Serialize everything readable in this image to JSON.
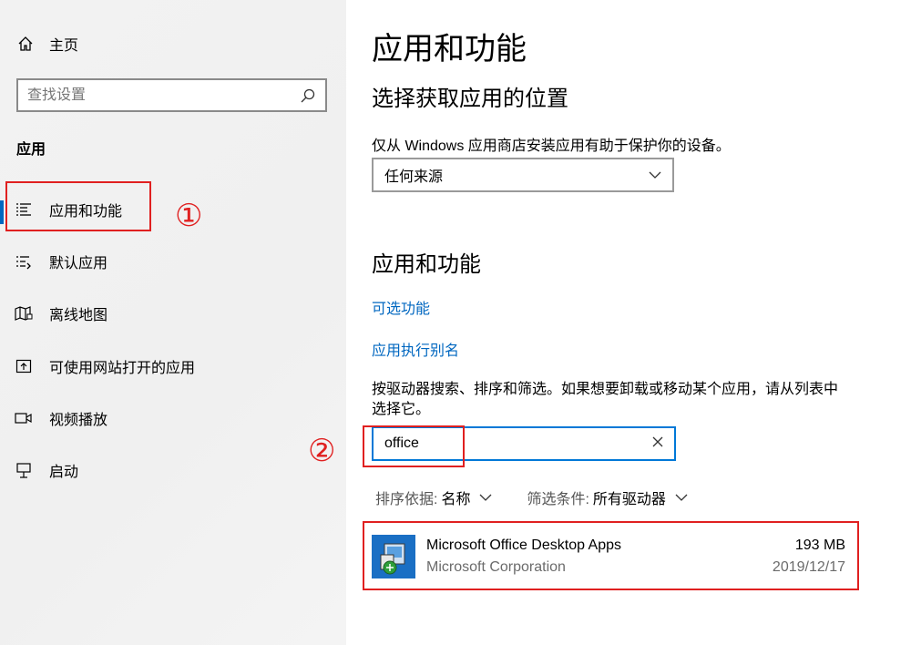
{
  "sidebar": {
    "home_label": "主页",
    "search_placeholder": "查找设置",
    "section_title": "应用",
    "items": [
      {
        "label": "应用和功能",
        "icon": "apps-features-icon"
      },
      {
        "label": "默认应用",
        "icon": "default-apps-icon"
      },
      {
        "label": "离线地图",
        "icon": "offline-maps-icon"
      },
      {
        "label": "可使用网站打开的应用",
        "icon": "apps-for-websites-icon"
      },
      {
        "label": "视频播放",
        "icon": "video-playback-icon"
      },
      {
        "label": "启动",
        "icon": "startup-icon"
      }
    ]
  },
  "annotations": {
    "num1": "①",
    "num2": "②",
    "color": "#e02020"
  },
  "main": {
    "title": "应用和功能",
    "choose_heading": "选择获取应用的位置",
    "choose_desc": "仅从 Windows 应用商店安装应用有助于保护你的设备。",
    "source_value": "任何来源",
    "apps_heading": "应用和功能",
    "link_optional": "可选功能",
    "link_alias": "应用执行别名",
    "list_desc_line1": "按驱动器搜索、排序和筛选。如果想要卸载或移动某个应用，请从列表中",
    "list_desc_line2": "选择它。",
    "search_value": "office",
    "sort_key": "排序依据:",
    "sort_value": "名称",
    "filter_key": "筛选条件:",
    "filter_value": "所有驱动器",
    "apps": [
      {
        "name": "Microsoft Office Desktop Apps",
        "publisher": "Microsoft Corporation",
        "size": "193 MB",
        "date": "2019/12/17"
      }
    ]
  },
  "colors": {
    "accent": "#0067c0",
    "search_border": "#0078d7"
  }
}
